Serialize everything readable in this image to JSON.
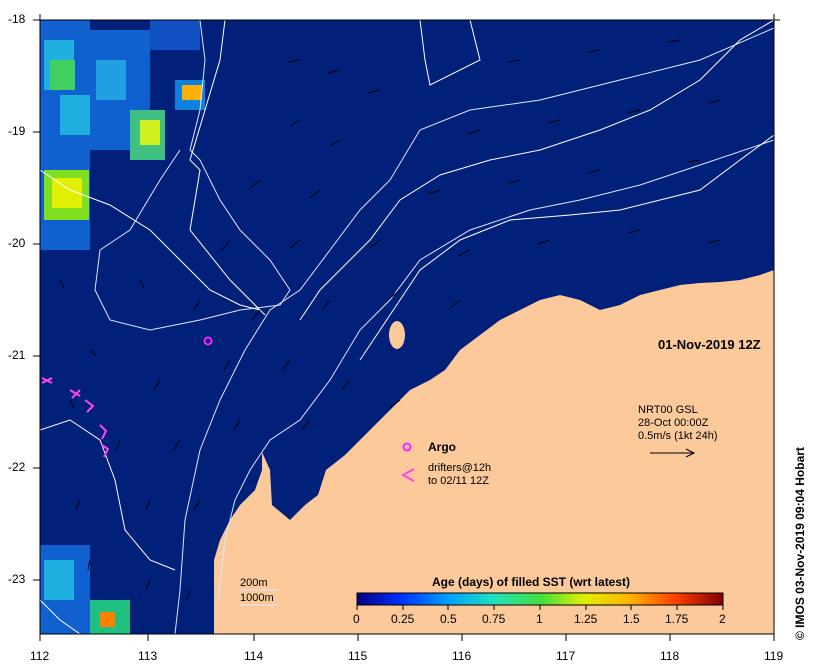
{
  "map": {
    "lon_ticks": [
      "112",
      "113",
      "114",
      "115",
      "116",
      "117",
      "118",
      "119"
    ],
    "lat_ticks": [
      "-18",
      "-19",
      "-20",
      "-21",
      "-22",
      "-23"
    ],
    "date_label": "01-Nov-2019 12Z",
    "current_ref": {
      "line1": "NRT00 GSL",
      "line2": "28-Oct 00:00Z",
      "line3": "0.5m/s (1kt 24h)"
    },
    "argo_label": "Argo",
    "drifters_line1": "drifters@12h",
    "drifters_line2": "to 02/11 12Z",
    "isobath_200": "200m",
    "isobath_1000": "1000m",
    "copyright": "© IMOS 03-Nov-2019 09:04 Hobart",
    "colors": {
      "ocean": "#00207a",
      "land": "#fcc99b",
      "argo": "#ff22ff",
      "drifter": "#ff44ee"
    }
  },
  "colorbar": {
    "title": "Age (days) of filled SST (wrt latest)",
    "ticks": [
      "0",
      "0.25",
      "0.5",
      "0.75",
      "1",
      "1.25",
      "1.5",
      "1.75",
      "2"
    ]
  }
}
